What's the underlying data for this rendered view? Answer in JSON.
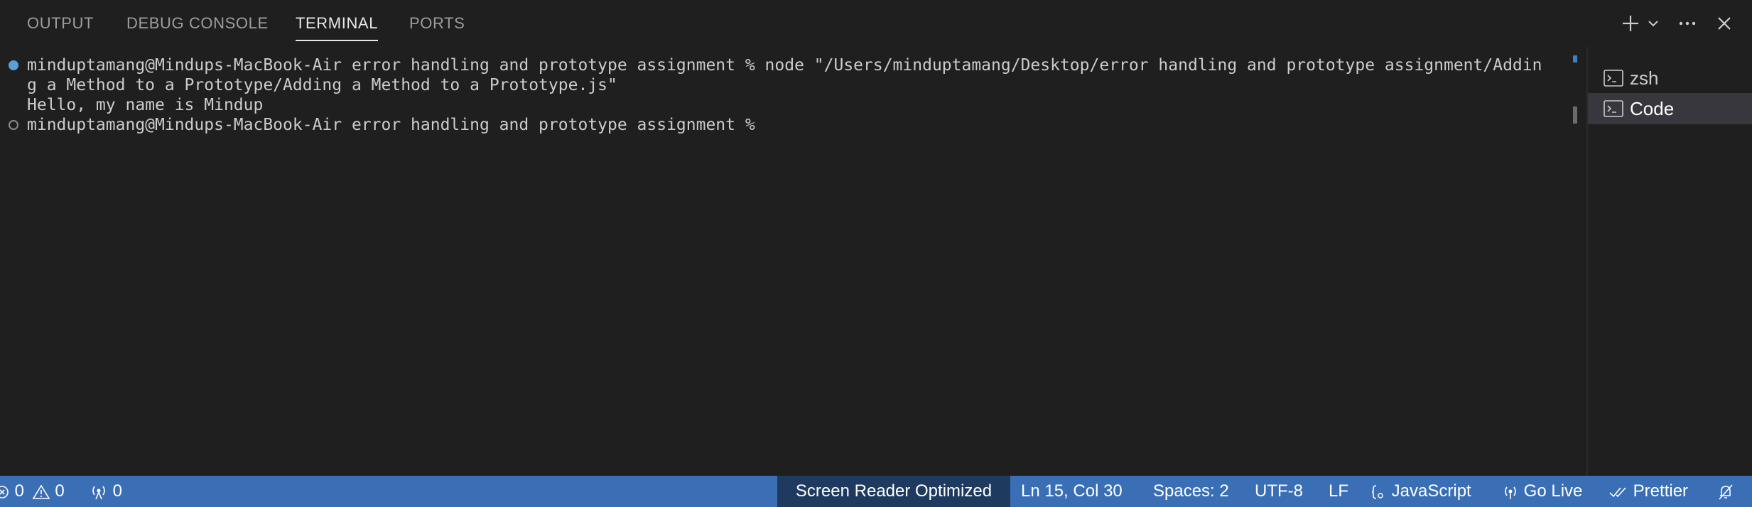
{
  "tabs": {
    "output": "OUTPUT",
    "debug_console": "DEBUG CONSOLE",
    "terminal": "TERMINAL",
    "ports": "PORTS"
  },
  "header_icons": [
    "plus-icon",
    "chevron-down-icon",
    "more-icon",
    "close-icon"
  ],
  "terminal": {
    "lines": [
      "minduptamang@Mindups-MacBook-Air error handling and prototype assignment % node \"/Users/minduptamang/Desktop/error handling and prototype assignment/Addin",
      "g a Method to a Prototype/Adding a Method to a Prototype.js\"",
      "Hello, my name is Mindup",
      "minduptamang@Mindups-MacBook-Air error handling and prototype assignment % "
    ]
  },
  "terminal_list": [
    {
      "label": "zsh",
      "icon": "terminal-icon"
    },
    {
      "label": "Code",
      "icon": "terminal-icon"
    }
  ],
  "statusbar": {
    "errors": "0",
    "warnings": "0",
    "ports": "0",
    "screen_reader": "Screen Reader Optimized",
    "position": "Ln 15, Col 30",
    "spaces": "Spaces: 2",
    "encoding": "UTF-8",
    "eol": "LF",
    "language": "JavaScript",
    "go_live": "Go Live",
    "prettier": "Prettier"
  },
  "colors": {
    "background": "#1f1f1f",
    "statusbar": "#3b6fb5",
    "decoration_success": "#5b9fd6"
  }
}
